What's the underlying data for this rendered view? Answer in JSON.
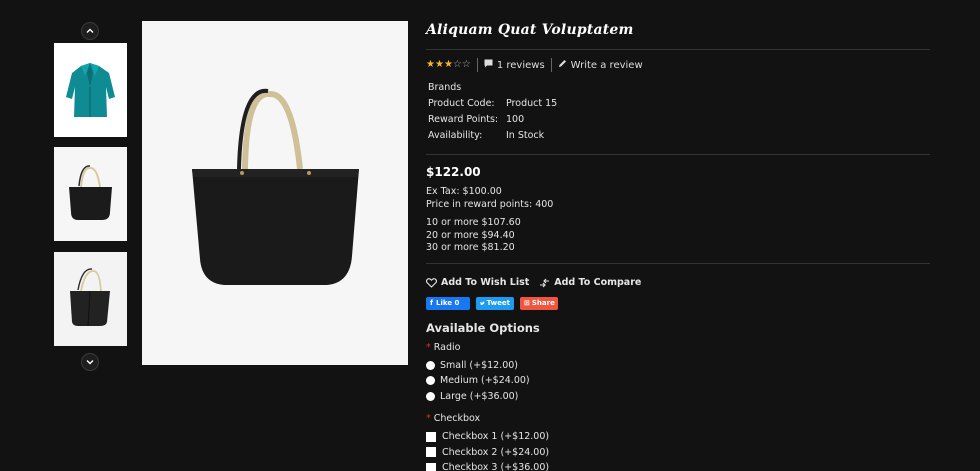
{
  "gallery": {
    "thumbnails": [
      "teal-shirt",
      "black-tote-front",
      "black-tote-side"
    ],
    "main_image": "black-tote-bag"
  },
  "product": {
    "title": "Aliquam Quat Voluptatem",
    "rating": 3,
    "rating_max": 5,
    "reviews_label": "1 reviews",
    "write_review_label": "Write a review",
    "specs": [
      {
        "key": "Brands",
        "value": ""
      },
      {
        "key": "Product Code:",
        "value": "Product 15"
      },
      {
        "key": "Reward Points:",
        "value": "100"
      },
      {
        "key": "Availability:",
        "value": "In Stock"
      }
    ],
    "price": "$122.00",
    "ex_tax": "Ex Tax: $100.00",
    "reward_price": "Price in reward points: 400",
    "discounts": [
      "10 or more $107.60",
      "20 or more $94.40",
      "30 or more $81.20"
    ]
  },
  "actions": {
    "wishlist": "Add To Wish List",
    "compare": "Add To Compare"
  },
  "social": {
    "like": "Like 0",
    "tweet": "Tweet",
    "share": "Share"
  },
  "options": {
    "title": "Available Options",
    "radio": {
      "label": "Radio",
      "items": [
        "Small (+$12.00)",
        "Medium (+$24.00)",
        "Large (+$36.00)"
      ]
    },
    "checkbox": {
      "label": "Checkbox",
      "items": [
        "Checkbox 1 (+$12.00)",
        "Checkbox 2 (+$24.00)",
        "Checkbox 3 (+$36.00)"
      ]
    }
  },
  "colors": {
    "background": "#121212",
    "star_on": "#f3b52b",
    "required": "#e02b2b",
    "facebook": "#1877f2",
    "twitter": "#1d9bf0",
    "share": "#f0553f"
  }
}
